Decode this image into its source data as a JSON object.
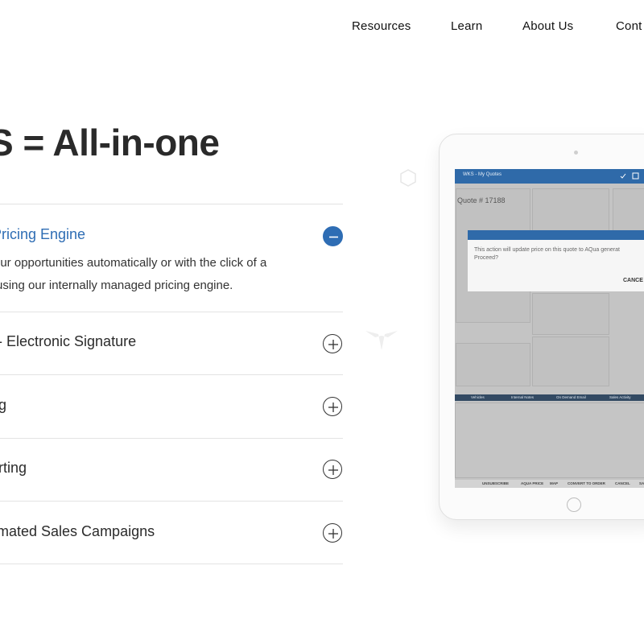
{
  "nav": {
    "items": [
      "Resources",
      "Learn",
      "About Us",
      "Cont"
    ]
  },
  "headline": "S = All-in-one",
  "accordion": [
    {
      "title": "Pricing Engine",
      "expanded": true,
      "description_lines": [
        "our opportunities automatically or with the click of a",
        "using our internally managed pricing engine."
      ]
    },
    {
      "title": "- Electronic Signature",
      "expanded": false
    },
    {
      "title": "g",
      "expanded": false
    },
    {
      "title": "rting",
      "expanded": false
    },
    {
      "title": "mated Sales Campaigns",
      "expanded": false
    }
  ],
  "tablet": {
    "app_title": "WKS - My Quotes",
    "quote_title": "Quote # 17188",
    "modal": {
      "text_lines": [
        "This action will update price on this quote to AQua generat",
        "Proceed?"
      ],
      "cancel_label": "CANCE"
    },
    "tabs": [
      "Vehicles",
      "Internal Notes",
      "On Demand Email",
      "Sales Activity"
    ],
    "bottom_actions": [
      "UNSUBSCRIBE",
      "AQUA PRICE",
      "MAP",
      "CONVERT TO ORDER",
      "CANCEL",
      "SA"
    ]
  },
  "colors": {
    "accent": "#2e6db4",
    "app_bar": "#2f6aa9"
  }
}
